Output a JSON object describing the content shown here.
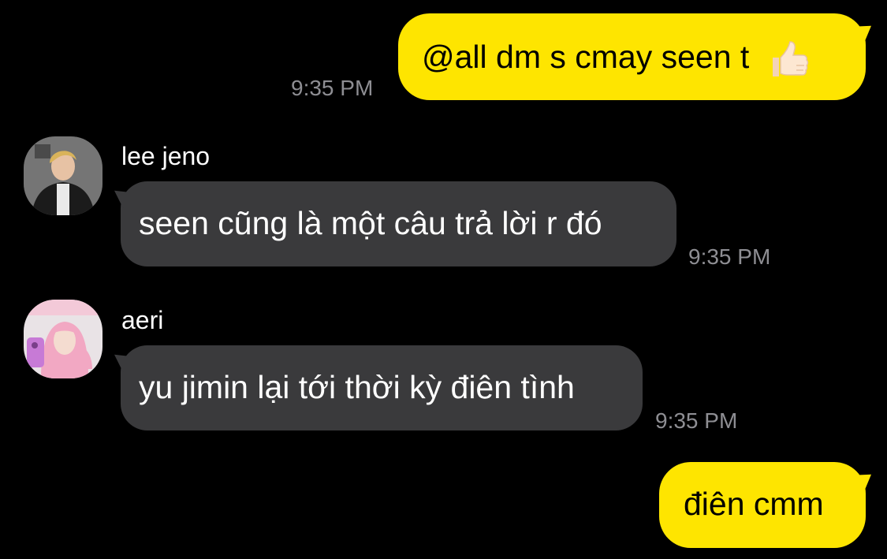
{
  "conversation": {
    "messages": [
      {
        "direction": "out",
        "text": "@all dm s cmay seen t",
        "emoji": "thumbs-up-icon",
        "time": "9:35 PM"
      },
      {
        "direction": "in",
        "sender": "lee jeno",
        "avatar": "avatar-lee-jeno",
        "text": "seen cũng là một câu trả lời r đó",
        "time": "9:35 PM"
      },
      {
        "direction": "in",
        "sender": "aeri",
        "avatar": "avatar-aeri",
        "text": "yu jimin lại tới thời kỳ điên tình",
        "time": "9:35 PM"
      },
      {
        "direction": "out",
        "text": "điên cmm"
      }
    ]
  },
  "theme": {
    "background": "#000000",
    "outgoing_bubble": "#fee500",
    "incoming_bubble": "#3a3a3c",
    "timestamp_color": "#8e8e93"
  }
}
